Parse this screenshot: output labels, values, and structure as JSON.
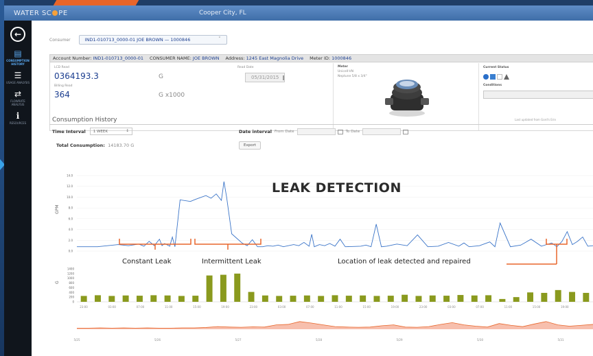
{
  "app": {
    "logo_left": "WATER SC",
    "logo_right": "PE",
    "city": "Cooper City, FL"
  },
  "sidebar": {
    "back_icon": "back-arrow-icon",
    "items": [
      {
        "icon": "bar-chart-icon",
        "label": "Consumption History",
        "active": true
      },
      {
        "icon": "list-icon",
        "label": "Usage Analysis",
        "active": false
      },
      {
        "icon": "shuffle-icon",
        "label": "Flowrate Analysis",
        "active": false
      },
      {
        "icon": "info-icon",
        "label": "Resources",
        "active": false
      }
    ]
  },
  "consumer": {
    "label": "Consumer",
    "selected": "IND1-010713_0000-01   JOE BROWN — 1000846"
  },
  "account": {
    "account_number_label": "Account Number:",
    "account_number": "IND1-010713_0000-01",
    "consumer_name_label": "CONSUMER NAME:",
    "consumer_name": "JOE BROWN",
    "address_label": "Address:",
    "address": "1245 East Magnolia Drive",
    "meter_id_label": "Meter ID:",
    "meter_id": "1000846"
  },
  "readings": {
    "lcd_label": "LCD Read",
    "lcd_value": "0364193.3",
    "lcd_unit": "G",
    "billing_label": "Billing Read",
    "billing_value": "364",
    "billing_unit": "G x1000",
    "read_date_label": "Read Date",
    "read_date": "05/31/2015"
  },
  "meter": {
    "label": "Meter",
    "model_line1": "Unicell-VN",
    "model_line2": "Neptune  5/8 x 3/4\""
  },
  "status": {
    "label": "Current Status",
    "conditions_label": "Conditions"
  },
  "history": {
    "title": "Consumption History",
    "updated_note": "Last updated from Gord's Erin",
    "time_interval_label": "Time Interval",
    "time_interval_value": "1 WEEK",
    "date_interval_label": "Date interval",
    "from_label": "From Date",
    "to_label": "To Date",
    "total_label": "Total Consumption:",
    "total_value": "14183.70  G",
    "export_label": "Export"
  },
  "annotations": {
    "title": "LEAK DETECTION",
    "constant": "Constant Leak",
    "intermittent": "Intermittent Leak",
    "location": "Location of leak detected and repaired"
  },
  "chart_data": [
    {
      "type": "line",
      "title": "",
      "ylabel": "GPM",
      "ylim": [
        0,
        14
      ],
      "yticks": [
        "14.0",
        "12.0",
        "10.0",
        "8.0",
        "6.0",
        "4.0",
        "2.0",
        "0.0"
      ],
      "series": [
        {
          "color": "#3a74c8",
          "x": [
            0,
            4,
            8,
            10,
            12,
            13,
            14,
            15,
            16,
            16.5,
            17,
            18,
            18.5,
            19,
            20,
            22,
            23,
            25,
            26,
            27,
            28,
            28.5,
            29,
            30,
            32,
            33,
            34,
            35,
            36,
            37,
            38,
            39,
            40,
            42,
            43,
            44,
            45,
            45.5,
            46,
            47,
            48,
            49,
            50,
            51,
            52,
            55,
            56,
            57,
            58,
            59,
            60,
            62,
            64,
            66,
            68,
            70,
            72,
            74,
            75,
            76,
            78,
            80,
            81,
            82,
            84,
            86,
            88,
            90,
            92,
            93,
            94,
            95,
            96,
            97,
            98,
            99,
            100
          ],
          "y": [
            0.8,
            0.8,
            1.2,
            1.0,
            1.3,
            0.9,
            1.8,
            1.0,
            2.2,
            1.0,
            1.4,
            0.9,
            2.6,
            0.8,
            9.5,
            9.2,
            9.6,
            10.3,
            9.8,
            10.6,
            9.4,
            12.9,
            10.1,
            3.2,
            1.5,
            1.0,
            2.1,
            0.8,
            0.8,
            1.0,
            0.9,
            1.1,
            0.8,
            1.2,
            1.0,
            1.6,
            0.9,
            3.1,
            0.8,
            1.2,
            1.0,
            1.4,
            0.9,
            2.2,
            0.8,
            0.9,
            1.1,
            0.8,
            5.0,
            0.8,
            0.9,
            1.3,
            1.0,
            3.0,
            0.8,
            0.9,
            1.6,
            0.9,
            1.5,
            0.8,
            1.0,
            1.7,
            0.8,
            5.2,
            0.8,
            1.1,
            2.2,
            0.9,
            1.5,
            0.8,
            1.8,
            3.6,
            1.2,
            1.8,
            2.6,
            0.9,
            1.0
          ]
        }
      ]
    },
    {
      "type": "bar",
      "ylabel": "G",
      "ylim": [
        0,
        1400
      ],
      "yticks": [
        "1400",
        "1200",
        "1000",
        "800",
        "600",
        "400",
        "200",
        "0"
      ],
      "values": [
        250,
        280,
        250,
        270,
        260,
        280,
        270,
        250,
        260,
        1120,
        1150,
        1200,
        420,
        270,
        250,
        260,
        270,
        250,
        280,
        260,
        270,
        250,
        260,
        300,
        250,
        270,
        260,
        290,
        270,
        280,
        120,
        200,
        400,
        380,
        500,
        420,
        380
      ],
      "color": "#8a9a1e",
      "x_tick_labels": [
        "23:00",
        "03:00",
        "07:00",
        "11:00",
        "15:00",
        "19:00",
        "23:00",
        "03:00",
        "07:00",
        "11:00",
        "15:00",
        "19:00",
        "23:00",
        "03:00",
        "07:00",
        "11:00",
        "15:00",
        "19:00"
      ]
    },
    {
      "type": "area",
      "color": "#f08b6a",
      "ylim": [
        0,
        10
      ],
      "values": [
        0.5,
        0.5,
        0.6,
        0.5,
        0.6,
        0.5,
        0.6,
        0.5,
        0.5,
        0.6,
        0.6,
        0.8,
        1.2,
        1.0,
        0.9,
        1.1,
        1.0,
        2.0,
        2.2,
        3.5,
        2.8,
        2.0,
        1.2,
        1.0,
        0.9,
        1.0,
        1.6,
        2.0,
        1.0,
        0.9,
        1.2,
        2.2,
        3.0,
        2.0,
        1.4,
        1.0,
        2.6,
        1.8,
        1.2,
        2.4,
        3.5,
        2.0,
        1.4,
        1.8,
        2.2
      ],
      "x_tick_labels": [
        "5/25",
        "5/26",
        "5/27",
        "5/28",
        "5/29",
        "5/30",
        "5/31"
      ]
    }
  ]
}
